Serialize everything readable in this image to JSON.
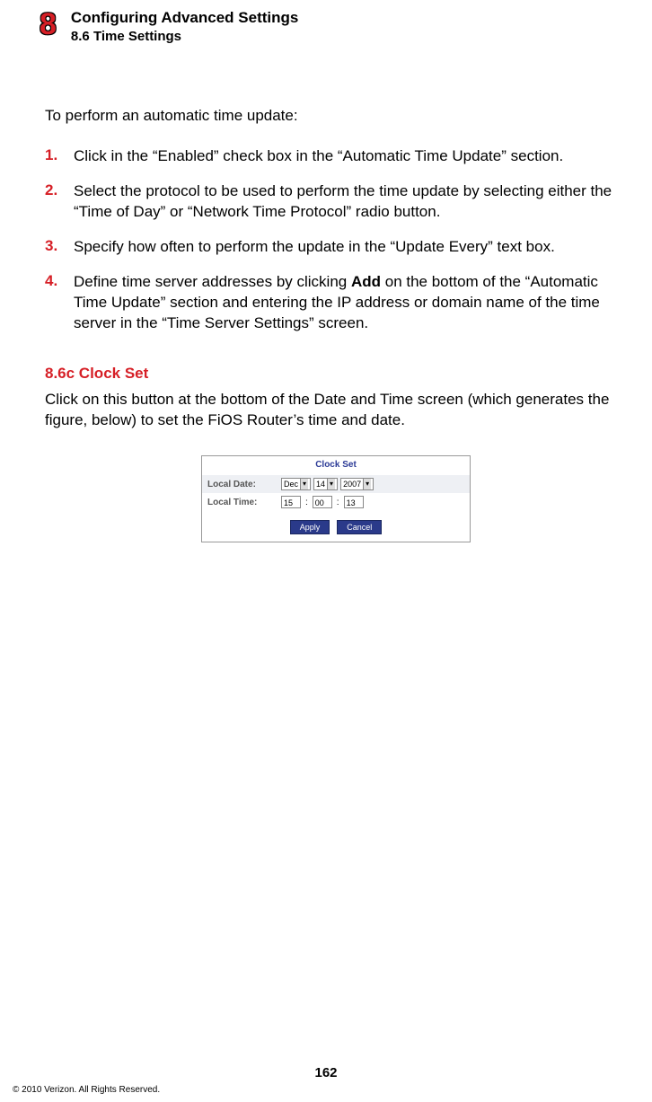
{
  "header": {
    "chapter_number": "8",
    "chapter_title": "Configuring Advanced Settings",
    "section_title": "8.6  Time Settings"
  },
  "intro": "To perform an automatic time update:",
  "steps": [
    {
      "n": "1.",
      "text": "Click in the “Enabled” check box in the “Automatic Time Update” section."
    },
    {
      "n": "2.",
      "text": "Select the protocol to be used to perform the time update by selecting either the “Time of Day” or “Network Time Protocol” radio button."
    },
    {
      "n": "3.",
      "text": "Specify how often to perform the update in the “Update Every” text box."
    },
    {
      "n": "4.",
      "text_before": "Define time server addresses by clicking ",
      "bold": "Add",
      "text_after": " on the bottom of the “Automatic Time Update” section and entering the IP address or domain name of the time server in the “Time Server Settings” screen."
    }
  ],
  "subheading": "8.6c  Clock Set",
  "sub_text": "Click on this button at the bottom of the Date and Time screen (which generates the figure, below) to set the FiOS Router’s time and date.",
  "figure": {
    "title": "Clock Set",
    "local_date_label": "Local Date:",
    "month": "Dec",
    "day": "14",
    "year": "2007",
    "local_time_label": "Local Time:",
    "hh": "15",
    "mm": "00",
    "ss": "13",
    "apply": "Apply",
    "cancel": "Cancel"
  },
  "page_number": "162",
  "copyright": "© 2010 Verizon. All Rights Reserved."
}
